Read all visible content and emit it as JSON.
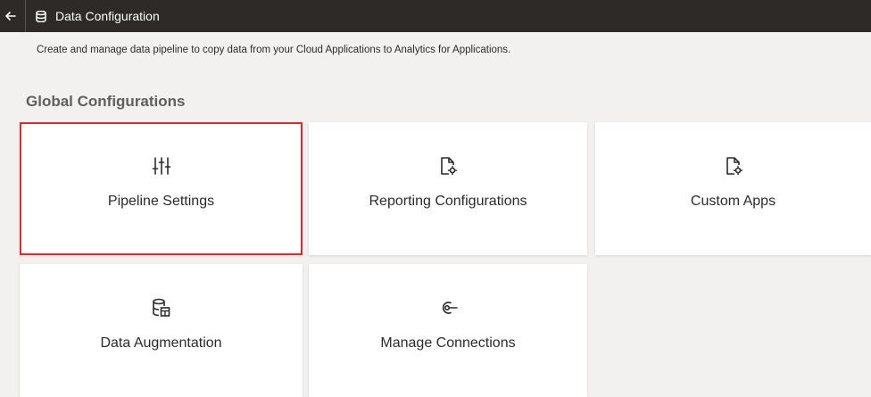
{
  "header": {
    "title": "Data Configuration",
    "back_icon": "arrow-left-icon",
    "title_icon": "database-icon"
  },
  "subtitle": "Create and manage data pipeline to copy data from your Cloud Applications to Analytics for Applications.",
  "section": {
    "heading": "Global Configurations"
  },
  "tiles": [
    {
      "label": "Pipeline Settings",
      "icon": "sliders-icon",
      "selected": true
    },
    {
      "label": "Reporting Configurations",
      "icon": "document-gear-icon",
      "selected": false
    },
    {
      "label": "Custom Apps",
      "icon": "document-gear-icon",
      "selected": false
    },
    {
      "label": "Data Augmentation",
      "icon": "database-table-icon",
      "selected": false
    },
    {
      "label": "Manage Connections",
      "icon": "connection-icon",
      "selected": false
    }
  ],
  "colors": {
    "titlebar_bg": "#2d2a27",
    "page_bg": "#f2f1f0",
    "selection_outline": "#d32f2f"
  }
}
